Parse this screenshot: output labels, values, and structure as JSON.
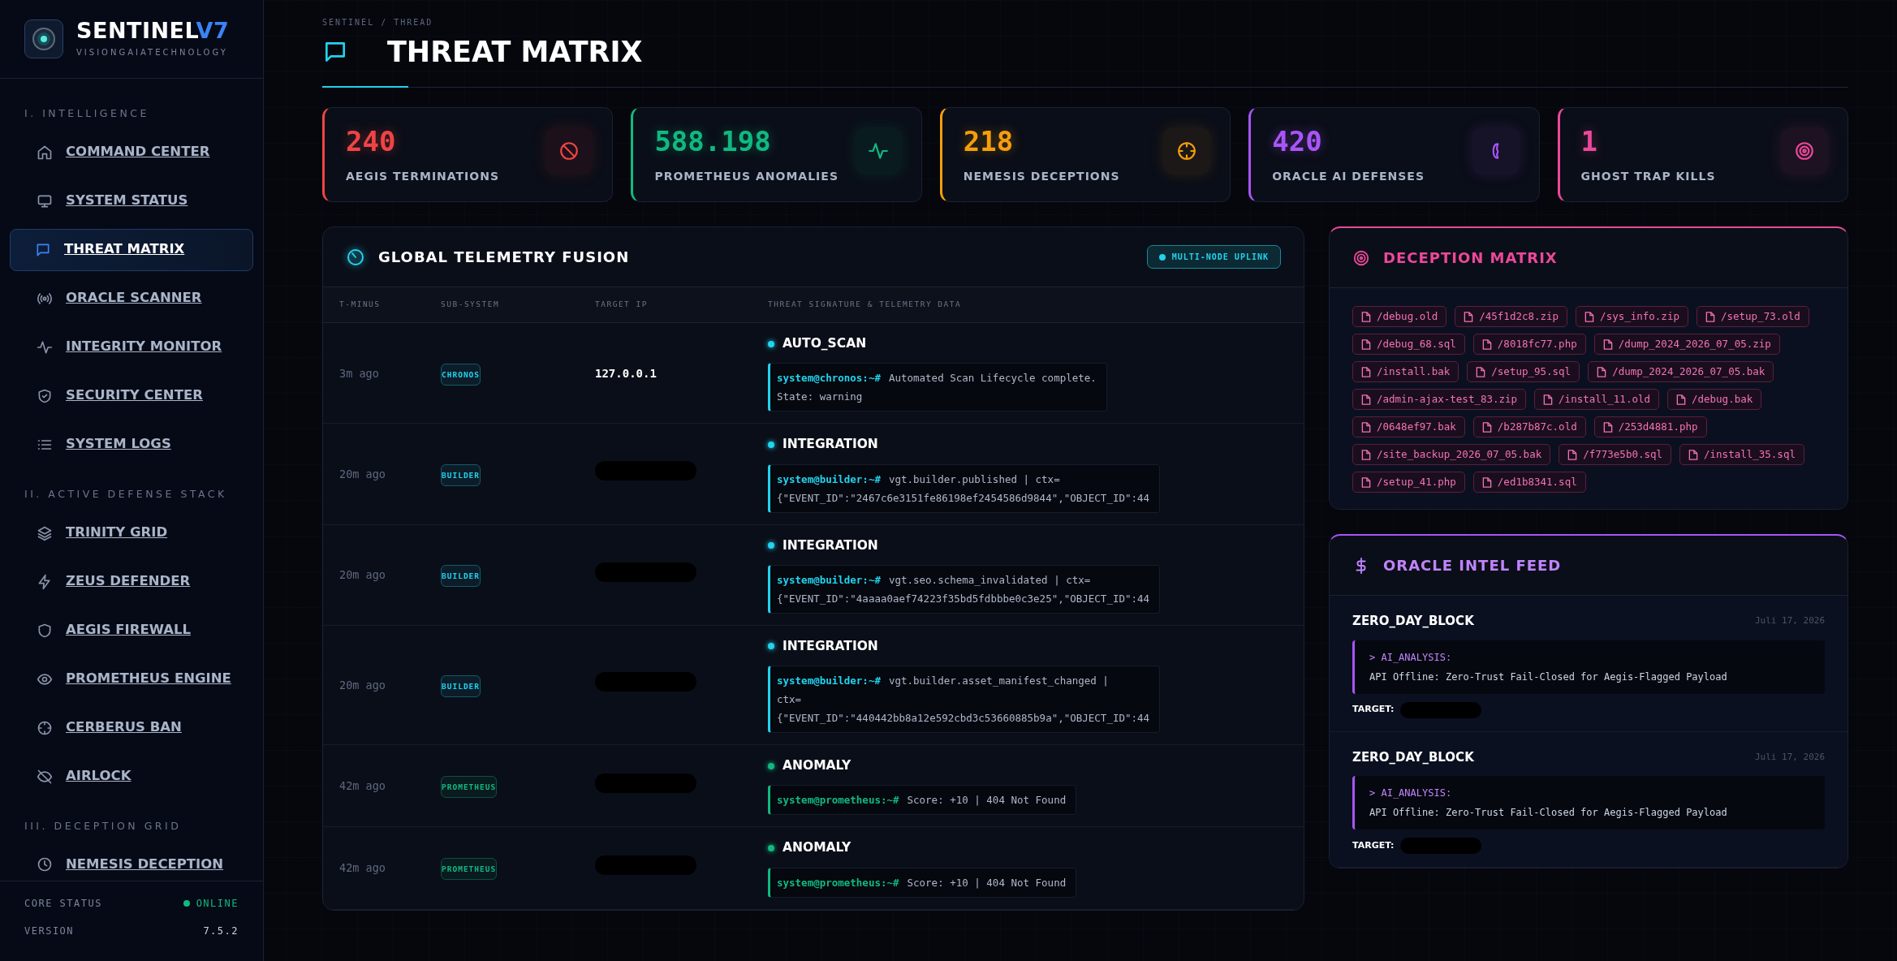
{
  "brand": {
    "name": "SENTINEL",
    "mark": "V7",
    "subtitle": "VISIONGAIATECHNOLOGY"
  },
  "sidebar": {
    "sections": [
      {
        "title": "I. INTELLIGENCE",
        "items": [
          {
            "label": "COMMAND CENTER",
            "selected": false
          },
          {
            "label": "SYSTEM STATUS",
            "selected": false
          },
          {
            "label": "THREAT MATRIX",
            "selected": true
          },
          {
            "label": "ORACLE SCANNER",
            "selected": false
          },
          {
            "label": "INTEGRITY MONITOR",
            "selected": false
          },
          {
            "label": "SECURITY CENTER",
            "selected": false
          },
          {
            "label": "SYSTEM LOGS",
            "selected": false
          }
        ]
      },
      {
        "title": "II. ACTIVE DEFENSE STACK",
        "items": [
          {
            "label": "TRINITY GRID",
            "selected": false
          },
          {
            "label": "ZEUS DEFENDER",
            "selected": false
          },
          {
            "label": "AEGIS FIREWALL",
            "selected": false
          },
          {
            "label": "PROMETHEUS ENGINE",
            "selected": false
          },
          {
            "label": "CERBERUS BAN",
            "selected": false
          },
          {
            "label": "AIRLOCK",
            "selected": false
          }
        ]
      },
      {
        "title": "III. DECEPTION GRID",
        "items": [
          {
            "label": "NEMESIS DECEPTION",
            "selected": false
          }
        ]
      }
    ],
    "footer": [
      {
        "label": "CORE STATUS",
        "value": "ONLINE",
        "kind": "status"
      },
      {
        "label": "VERSION",
        "value": "7.5.2",
        "kind": "text"
      }
    ]
  },
  "header": {
    "breadcrumb": "SENTINEL / THREAD",
    "title": "THREAT MATRIX"
  },
  "stats": [
    {
      "value": "240",
      "label": "AEGIS TERMINATIONS",
      "color": "#ef4444"
    },
    {
      "value": "588.198",
      "label": "PROMETHEUS ANOMALIES",
      "color": "#10b981"
    },
    {
      "value": "218",
      "label": "NEMESIS DECEPTIONS",
      "color": "#f59e0b"
    },
    {
      "value": "420",
      "label": "ORACLE AI DEFENSES",
      "color": "#a855f7"
    },
    {
      "value": "1",
      "label": "GHOST TRAP KILLS",
      "color": "#ec4899"
    }
  ],
  "telemetry": {
    "title": "GLOBAL TELEMETRY FUSION",
    "badge": "MULTI-NODE UPLINK",
    "columns": [
      "T-MINUS",
      "SUB-SYSTEM",
      "TARGET IP",
      "THREAT SIGNATURE & TELEMETRY DATA"
    ],
    "rows": [
      {
        "time": "3m ago",
        "subsystem": "CHRONOS",
        "target_ip": "127.0.0.1",
        "redacted": false,
        "event": "AUTO_SCAN",
        "prompt": "system@chronos:~#",
        "lines": [
          "Automated Scan Lifecycle complete.",
          "State: warning"
        ],
        "color": "#22d3ee"
      },
      {
        "time": "20m ago",
        "subsystem": "BUILDER",
        "redacted": true,
        "event": "INTEGRATION",
        "prompt": "system@builder:~#",
        "lines": [
          "vgt.builder.published | ctx=",
          "{\"EVENT_ID\":\"2467c6e3151fe86198ef2454586d9844\",\"OBJECT_ID\":44"
        ],
        "color": "#22d3ee"
      },
      {
        "time": "20m ago",
        "subsystem": "BUILDER",
        "redacted": true,
        "event": "INTEGRATION",
        "prompt": "system@builder:~#",
        "lines": [
          "vgt.seo.schema_invalidated | ctx=",
          "{\"EVENT_ID\":\"4aaaa0aef74223f35bd5fdbbbe0c3e25\",\"OBJECT_ID\":44"
        ],
        "color": "#22d3ee"
      },
      {
        "time": "20m ago",
        "subsystem": "BUILDER",
        "redacted": true,
        "event": "INTEGRATION",
        "prompt": "system@builder:~#",
        "lines": [
          "vgt.builder.asset_manifest_changed |",
          "ctx=",
          "{\"EVENT_ID\":\"440442bb8a12e592cbd3c53660885b9a\",\"OBJECT_ID\":44"
        ],
        "color": "#22d3ee"
      },
      {
        "time": "42m ago",
        "subsystem": "PROMETHEUS",
        "redacted": true,
        "event": "ANOMALY",
        "prompt": "system@prometheus:~#",
        "lines": [
          "Score: +10 | 404 Not Found"
        ],
        "color": "#10b981"
      },
      {
        "time": "42m ago",
        "subsystem": "PROMETHEUS",
        "redacted": true,
        "event": "ANOMALY",
        "prompt": "system@prometheus:~#",
        "lines": [
          "Score: +10 | 404 Not Found"
        ],
        "color": "#10b981"
      }
    ]
  },
  "deception": {
    "title": "DECEPTION MATRIX",
    "files": [
      "/debug.old",
      "/45f1d2c8.zip",
      "/sys_info.zip",
      "/setup_73.old",
      "/debug_68.sql",
      "/8018fc77.php",
      "/dump_2024_2026_07_05.zip",
      "/install.bak",
      "/setup_95.sql",
      "/dump_2024_2026_07_05.bak",
      "/admin-ajax-test_83.zip",
      "/install_11.old",
      "/debug.bak",
      "/0648ef97.bak",
      "/b287b87c.old",
      "/253d4881.php",
      "/site_backup_2026_07_05.bak",
      "/f773e5b0.sql",
      "/install_35.sql",
      "/setup_41.php",
      "/ed1b8341.sql"
    ]
  },
  "oracle": {
    "title": "ORACLE INTEL FEED",
    "entries": [
      {
        "title": "ZERO_DAY_BLOCK",
        "date": "Juli 17, 2026",
        "analysis_label": "> AI_ANALYSIS:",
        "analysis": "API Offline: Zero-Trust Fail-Closed for Aegis-Flagged Payload",
        "target_label": "TARGET:",
        "target_redacted": true
      },
      {
        "title": "ZERO_DAY_BLOCK",
        "date": "Juli 17, 2026",
        "analysis_label": "> AI_ANALYSIS:",
        "analysis": "API Offline: Zero-Trust Fail-Closed for Aegis-Flagged Payload",
        "target_label": "TARGET:",
        "target_redacted": true
      }
    ]
  }
}
